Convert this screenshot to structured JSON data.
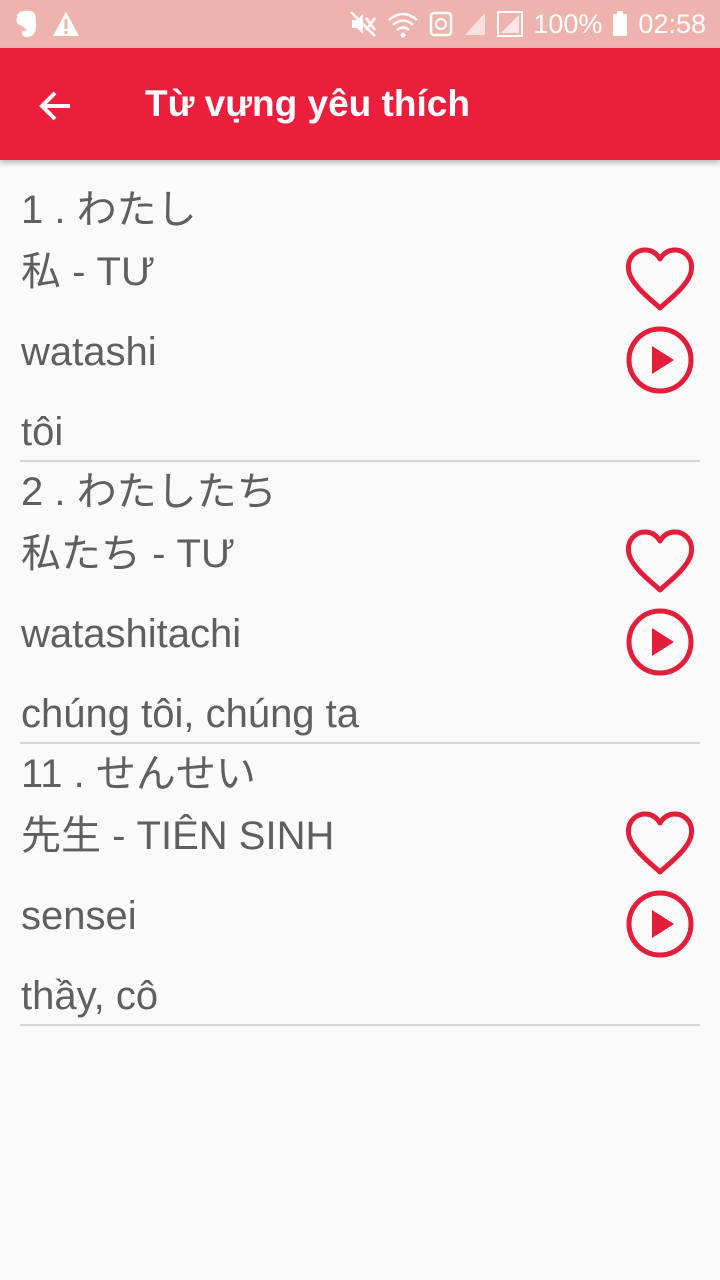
{
  "status_bar": {
    "battery": "100%",
    "time": "02:58",
    "icons": [
      "evernote-icon",
      "warning-icon",
      "mute-icon",
      "wifi-icon",
      "vpn-icon",
      "signal-icon",
      "signal-icon",
      "battery-icon"
    ]
  },
  "app_bar": {
    "title": "Từ vựng yêu thích",
    "back_icon": "arrow-left-icon",
    "color": "#eb1f3b"
  },
  "vocab": [
    {
      "line1": "1 . わたし",
      "line2": "私 - TƯ",
      "line3": "watashi",
      "line4": "tôi"
    },
    {
      "line1": "2 . わたしたち",
      "line2": "私たち - TƯ",
      "line3": "watashitachi",
      "line4": "chúng tôi, chúng ta"
    },
    {
      "line1": "11 . せんせい",
      "line2": "先生 - TIÊN SINH",
      "line3": "sensei",
      "line4": "thầy, cô"
    }
  ],
  "item_actions": {
    "favorite_icon": "heart-icon",
    "play_icon": "play-icon"
  }
}
